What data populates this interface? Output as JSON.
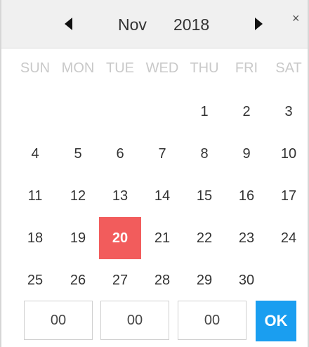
{
  "header": {
    "month": "Nov",
    "year": "2018",
    "prev_icon": "triangle-left-icon",
    "next_icon": "triangle-right-icon",
    "close_label": "×"
  },
  "weekdays": [
    "SUN",
    "MON",
    "TUE",
    "WED",
    "THU",
    "FRI",
    "SAT"
  ],
  "days": [
    "1",
    "2",
    "3",
    "4",
    "5",
    "6",
    "7",
    "8",
    "9",
    "10",
    "11",
    "12",
    "13",
    "14",
    "15",
    "16",
    "17",
    "18",
    "19",
    "20",
    "21",
    "22",
    "23",
    "24",
    "25",
    "26",
    "27",
    "28",
    "29",
    "30"
  ],
  "selected_day": "20",
  "time": {
    "hour": "00",
    "minute": "00",
    "second": "00"
  },
  "ok_label": "OK",
  "colors": {
    "selected": "#f25c5c",
    "ok_button": "#1a9ef0",
    "weekday_text": "#c9c9c9",
    "header_bg": "#f0f0f0"
  }
}
